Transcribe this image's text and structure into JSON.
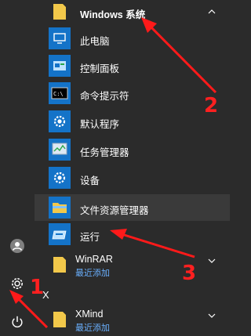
{
  "start_menu": {
    "groups": {
      "windows_system": {
        "title": "Windows 系统"
      },
      "winrar": {
        "title": "WinRAR",
        "subtitle": "最近添加"
      },
      "letter_x": "X",
      "xmind": {
        "title": "XMind",
        "subtitle": "最近添加"
      }
    },
    "items": [
      {
        "label": "此电脑",
        "icon": "computer-icon"
      },
      {
        "label": "控制面板",
        "icon": "control-panel-icon"
      },
      {
        "label": "命令提示符",
        "icon": "command-prompt-icon"
      },
      {
        "label": "默认程序",
        "icon": "gear-icon"
      },
      {
        "label": "任务管理器",
        "icon": "task-manager-icon"
      },
      {
        "label": "设备",
        "icon": "gear-icon"
      },
      {
        "label": "文件资源管理器",
        "icon": "folder-icon"
      },
      {
        "label": "运行",
        "icon": "run-icon"
      }
    ]
  },
  "annotations": {
    "n1": "1",
    "n2": "2",
    "n3": "3"
  },
  "colors": {
    "tile_blue": "#1473c8",
    "folder_yellow": "#f2c84a",
    "annotation_red": "#ff1a1a",
    "recent_blue": "#6ab0ff"
  }
}
